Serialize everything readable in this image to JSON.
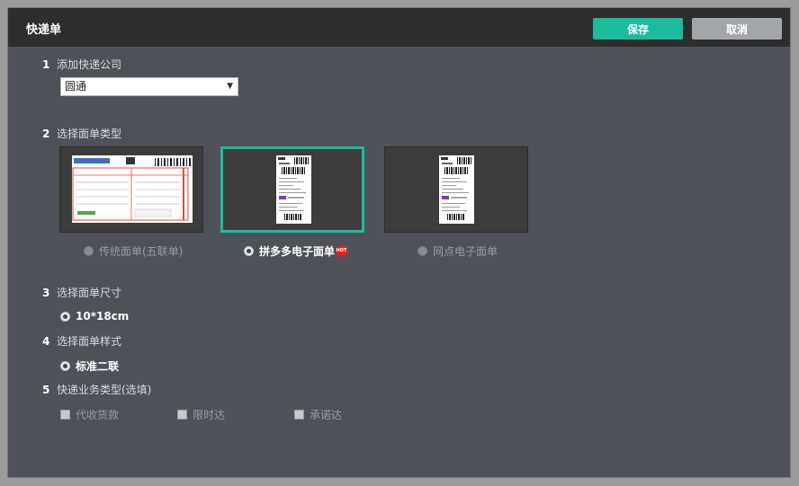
{
  "dialog": {
    "title": "快递单",
    "save_label": "保存",
    "cancel_label": "取消"
  },
  "sections": [
    {
      "num": "1",
      "label": "添加快递公司"
    },
    {
      "num": "2",
      "label": "选择面单类型"
    },
    {
      "num": "3",
      "label": "选择面单尺寸"
    },
    {
      "num": "4",
      "label": "选择面单样式"
    },
    {
      "num": "5",
      "label": "快递业务类型(选填)"
    }
  ],
  "courier": {
    "selected": "圆通"
  },
  "waybill_types": [
    {
      "label": "传统面单(五联单)",
      "selected": false
    },
    {
      "label": "拼多多电子面单",
      "selected": true,
      "badge": "HOT"
    },
    {
      "label": "网点电子面单",
      "selected": false
    }
  ],
  "size": {
    "label": "10*18cm"
  },
  "style": {
    "label": "标准二联"
  },
  "business_types": [
    {
      "label": "代收货款"
    },
    {
      "label": "限时达"
    },
    {
      "label": "承诺达"
    }
  ],
  "colors": {
    "accent": "#1abc9c",
    "header": "#2e2e2e",
    "panel": "#4f5158",
    "hot_badge": "#e0201e"
  }
}
